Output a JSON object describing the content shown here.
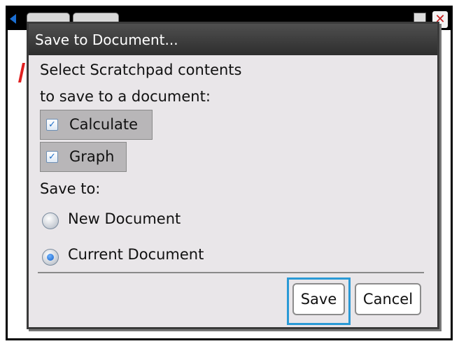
{
  "dialog": {
    "title": "Save to Document...",
    "prompt_line1": "Select Scratchpad contents",
    "prompt_line2": "to save to a document:",
    "options": [
      {
        "label": "Calculate",
        "checked": true
      },
      {
        "label": "Graph",
        "checked": true
      }
    ],
    "save_to_label": "Save to:",
    "destinations": [
      {
        "label": "New Document",
        "selected": false
      },
      {
        "label": "Current Document",
        "selected": true
      }
    ],
    "save_button": "Save",
    "cancel_button": "Cancel"
  },
  "colors": {
    "title_bar": "#3a3a3a",
    "dialog_bg": "#e9e6e9",
    "focus": "#2a9ad6",
    "checkbox_bg": "#b8b6b8",
    "accent": "#1460c8"
  },
  "icons": {
    "checkmark": "check-icon",
    "close": "close-icon",
    "back": "left-arrow-icon",
    "document": "document-icon"
  }
}
